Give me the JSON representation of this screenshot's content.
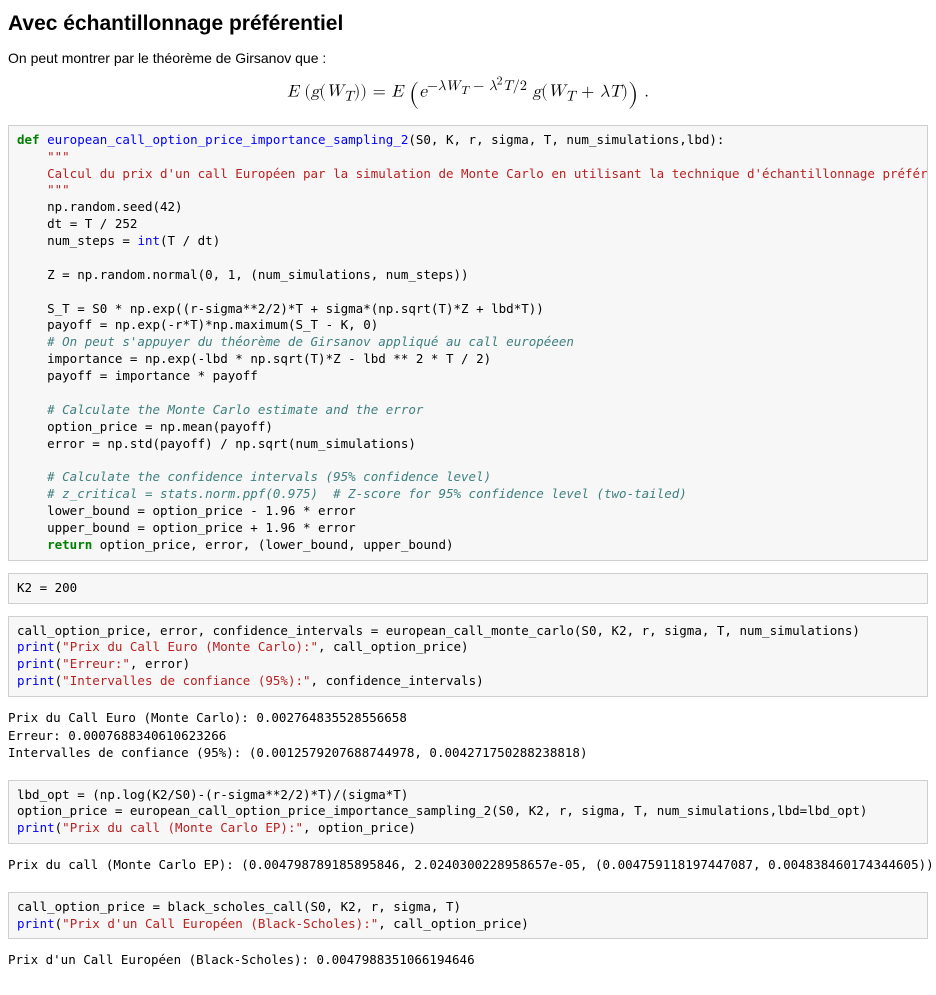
{
  "heading": "Avec échantillonnage préférentiel",
  "intro": "On peut montrer par le théorème de Girsanov que :",
  "formula_plain": "E(g(W_T)) = E( e^{-λW_T - λ²T/2} g(W_T + λT) ).",
  "code1": {
    "def_kw": "def",
    "fname": "european_call_option_price_importance_sampling_2",
    "params": "(S0, K, r, sigma, T, num_simulations,lbd):",
    "docstring_open": "\"\"\"",
    "docstring_body": "Calcul du prix d'un call Européen par la simulation de Monte Carlo en utilisant la technique d'échantillonnage préférentiel",
    "docstring_close": "\"\"\"",
    "l_seed": "np.random.seed(42)",
    "l_dt_a": "dt ",
    "l_dt_b": "= T / 252",
    "l_ns_a": "num_steps ",
    "l_ns_b": "= ",
    "l_ns_c": "int",
    "l_ns_d": "(T / dt)",
    "l_Z_a": "Z ",
    "l_Z_b": "= np.random.normal(0, 1, (num_simulations, num_steps))",
    "l_ST_a": "S_T ",
    "l_ST_b": "= S0 * np.exp((r-sigma**2/2)*T + sigma*(np.sqrt(T)*Z + lbd*T))",
    "l_pay_a": "payoff ",
    "l_pay_b": "= np.exp(-r*T)*np.maximum(S_T - K, 0)",
    "cmt1": "# On peut s'appuyer du théorème de Girsanov appliqué au call européeen",
    "l_imp_a": "importance ",
    "l_imp_b": "= np.exp(-lbd * np.sqrt(T)*Z - lbd ** 2 * T / 2)",
    "l_pay2_a": "payoff ",
    "l_pay2_b": "= importance * payoff",
    "cmt2": "# Calculate the Monte Carlo estimate and the error",
    "l_op_a": "option_price ",
    "l_op_b": "= np.mean(payoff)",
    "l_err_a": "error ",
    "l_err_b": "= np.std(payoff) / np.sqrt(num_simulations)",
    "cmt3": "# Calculate the confidence intervals (95% confidence level)",
    "cmt4": "# z_critical = stats.norm.ppf(0.975)  # Z-score for 95% confidence level (two-tailed)",
    "l_lb_a": "lower_bound ",
    "l_lb_b": "= option_price - 1.96 * error",
    "l_ub_a": "upper_bound ",
    "l_ub_b": "= option_price + 1.96 * error",
    "ret_kw": "return",
    "ret_rest": " option_price, error, (lower_bound, upper_bound)"
  },
  "code2": {
    "line": "K2 = 200"
  },
  "code3": {
    "l1a": "call_option_price, error, confidence_intervals ",
    "l1b": "= european_call_monte_carlo(S0, K2, r, sigma, T, num_simulations)",
    "p1a": "print",
    "p1b": "(",
    "p1s": "\"Prix du Call Euro (Monte Carlo):\"",
    "p1c": ", call_option_price)",
    "p2a": "print",
    "p2b": "(",
    "p2s": "\"Erreur:\"",
    "p2c": ", error)",
    "p3a": "print",
    "p3b": "(",
    "p3s": "\"Intervalles de confiance (95%):\"",
    "p3c": ", confidence_intervals)"
  },
  "out3": "Prix du Call Euro (Monte Carlo): 0.002764835528556658\nErreur: 0.0007688340610623266\nIntervalles de confiance (95%): (0.0012579207688744978, 0.004271750288238818)",
  "code4": {
    "l1a": "lbd_opt ",
    "l1b": "= (np.log(K2/S0)-(r-sigma**2/2)*T)/(sigma*T)",
    "l2a": "option_price ",
    "l2b": "= european_call_option_price_importance_sampling_2(S0, K2, r, sigma, T, num_simulations,lbd=lbd_opt)",
    "p1a": "print",
    "p1b": "(",
    "p1s": "\"Prix du call (Monte Carlo EP):\"",
    "p1c": ", option_price)"
  },
  "out4": "Prix du call (Monte Carlo EP): (0.004798789185895846, 2.0240300228958657e-05, (0.004759118197447087, 0.004838460174344605))",
  "code5": {
    "l1a": "call_option_price ",
    "l1b": "= black_scholes_call(S0, K2, r, sigma, T)",
    "p1a": "print",
    "p1b": "(",
    "p1s": "\"Prix d'un Call Européen (Black-Scholes):\"",
    "p1c": ", call_option_price)"
  },
  "out5": "Prix d'un Call Européen (Black-Scholes): 0.0047988351066194646"
}
